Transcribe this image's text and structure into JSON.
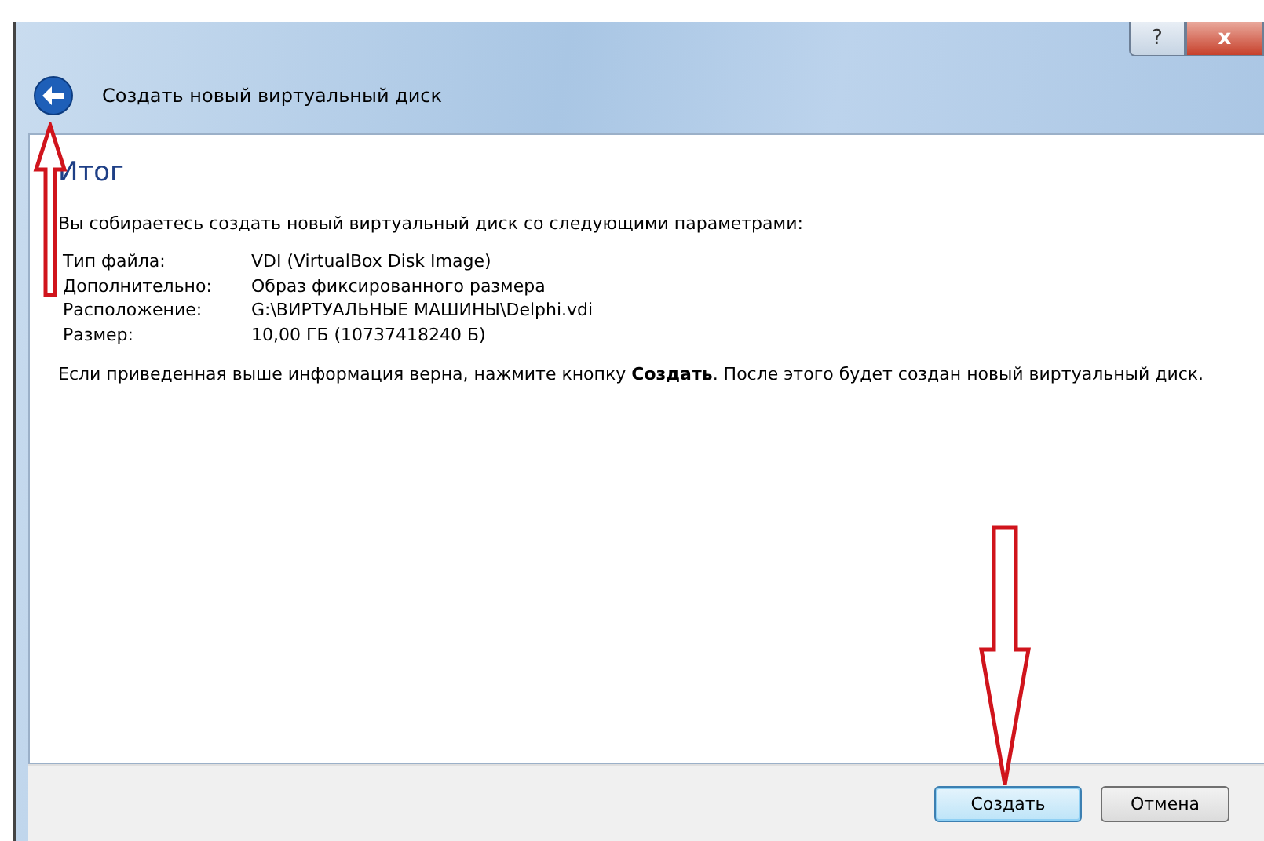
{
  "window": {
    "title": "Создать новый виртуальный диск",
    "help_button": "?",
    "close_button": "x"
  },
  "page": {
    "heading": "Итог",
    "intro": "Вы собираетесь создать новый виртуальный диск со следующими параметрами:",
    "params": [
      {
        "label": "Тип файла:",
        "value": "VDI (VirtualBox Disk Image)"
      },
      {
        "label": "Дополнительно:",
        "value": "Образ фиксированного размера"
      },
      {
        "label": "Расположение:",
        "value": "G:\\ВИРТУАЛЬНЫЕ МАШИНЫ\\Delphi.vdi"
      },
      {
        "label": "Размер:",
        "value": "10,00 ГБ (10737418240 Б)"
      }
    ],
    "note": "Если приведенная выше информация верна, нажмите кнопку **Создать**. После этого будет создан новый виртуальный диск."
  },
  "buttons": [
    {
      "label": "Создать",
      "selected": true
    },
    {
      "label": "Отмена",
      "selected": false
    }
  ]
}
